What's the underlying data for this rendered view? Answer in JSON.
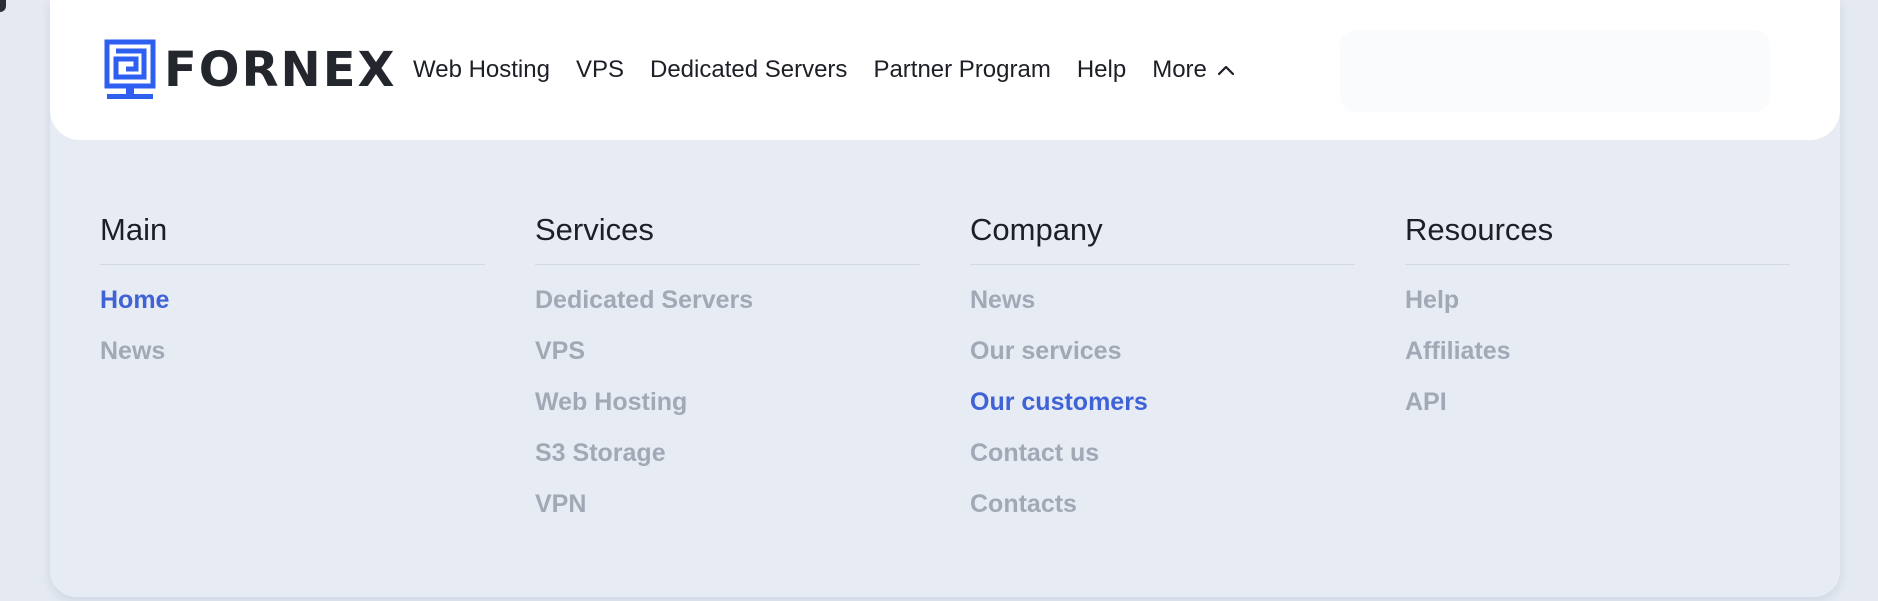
{
  "brand": {
    "name": "FORNEX",
    "accent_color": "#2f5ff0",
    "logo_icon": "fornex-logo-icon"
  },
  "nav": {
    "items": [
      {
        "label": "Web Hosting"
      },
      {
        "label": "VPS"
      },
      {
        "label": "Dedicated Servers"
      },
      {
        "label": "Partner Program"
      },
      {
        "label": "Help"
      },
      {
        "label": "More",
        "icon": "chevron-up-icon",
        "expanded": true
      }
    ]
  },
  "menu": {
    "active_color": "#3f63d6",
    "inactive_color": "#a2a9b6",
    "columns": [
      {
        "title": "Main",
        "links": [
          {
            "label": "Home",
            "active": true
          },
          {
            "label": "News",
            "active": false
          }
        ]
      },
      {
        "title": "Services",
        "links": [
          {
            "label": "Dedicated Servers",
            "active": false
          },
          {
            "label": "VPS",
            "active": false
          },
          {
            "label": "Web Hosting",
            "active": false
          },
          {
            "label": "S3 Storage",
            "active": false
          },
          {
            "label": "VPN",
            "active": false
          }
        ]
      },
      {
        "title": "Company",
        "links": [
          {
            "label": "News",
            "active": false
          },
          {
            "label": "Our services",
            "active": false
          },
          {
            "label": "Our customers",
            "active": true
          },
          {
            "label": "Contact us",
            "active": false
          },
          {
            "label": "Contacts",
            "active": false
          }
        ]
      },
      {
        "title": "Resources",
        "links": [
          {
            "label": "Help",
            "active": false
          },
          {
            "label": "Affiliates",
            "active": false
          },
          {
            "label": "API",
            "active": false
          }
        ]
      }
    ]
  }
}
